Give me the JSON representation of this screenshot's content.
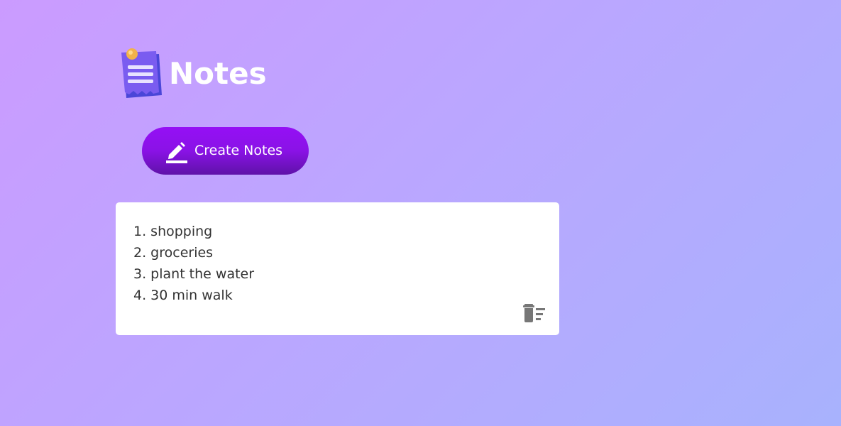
{
  "app": {
    "title": "Notes",
    "logo_icon": "notepad-pin-icon"
  },
  "toolbar": {
    "create_label": "Create Notes",
    "create_icon": "pencil-icon"
  },
  "notes": [
    {
      "lines": [
        "1. shopping",
        "2. groceries",
        "3. plant the water",
        "4. 30 min walk"
      ],
      "delete_icon": "delete-sweep-icon"
    }
  ],
  "colors": {
    "background_start": "#cb9bff",
    "background_end": "#a8b2fd",
    "button_start": "#9510f5",
    "button_end": "#5f12a8",
    "note_background": "#ffffff",
    "note_text": "#333333",
    "icon_gray": "#777777"
  }
}
